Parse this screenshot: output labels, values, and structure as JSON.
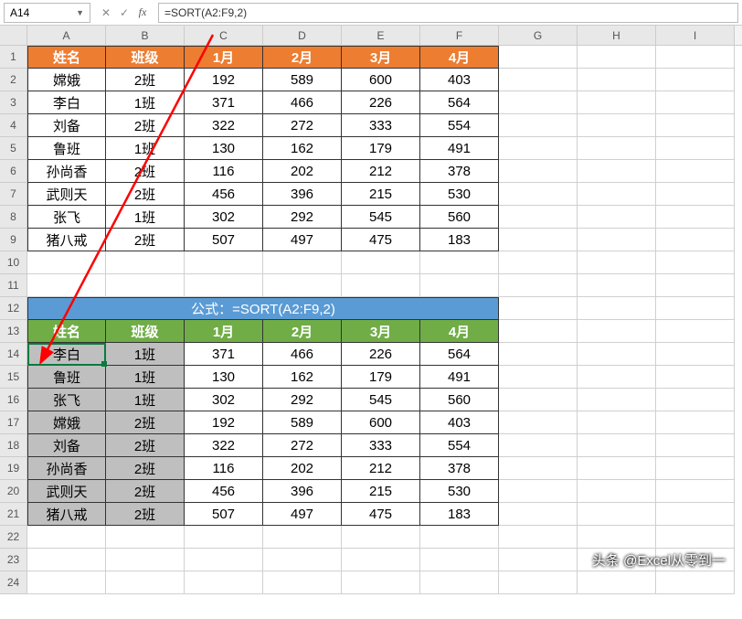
{
  "name_box": "A14",
  "formula": "=SORT(A2:F9,2)",
  "columns": [
    "A",
    "B",
    "C",
    "D",
    "E",
    "F",
    "G",
    "H",
    "I"
  ],
  "row_numbers": [
    "1",
    "2",
    "3",
    "4",
    "5",
    "6",
    "7",
    "8",
    "9",
    "10",
    "11",
    "12",
    "13",
    "14",
    "15",
    "16",
    "17",
    "18",
    "19",
    "20",
    "21",
    "22",
    "23",
    "24"
  ],
  "table1": {
    "headers": [
      "姓名",
      "班级",
      "1月",
      "2月",
      "3月",
      "4月"
    ],
    "rows": [
      [
        "嫦娥",
        "2班",
        "192",
        "589",
        "600",
        "403"
      ],
      [
        "李白",
        "1班",
        "371",
        "466",
        "226",
        "564"
      ],
      [
        "刘备",
        "2班",
        "322",
        "272",
        "333",
        "554"
      ],
      [
        "鲁班",
        "1班",
        "130",
        "162",
        "179",
        "491"
      ],
      [
        "孙尚香",
        "2班",
        "116",
        "202",
        "212",
        "378"
      ],
      [
        "武则天",
        "2班",
        "456",
        "396",
        "215",
        "530"
      ],
      [
        "张飞",
        "1班",
        "302",
        "292",
        "545",
        "560"
      ],
      [
        "猪八戒",
        "2班",
        "507",
        "497",
        "475",
        "183"
      ]
    ]
  },
  "banner": "公式：=SORT(A2:F9,2)",
  "table2": {
    "headers": [
      "姓名",
      "班级",
      "1月",
      "2月",
      "3月",
      "4月"
    ],
    "rows": [
      [
        "李白",
        "1班",
        "371",
        "466",
        "226",
        "564"
      ],
      [
        "鲁班",
        "1班",
        "130",
        "162",
        "179",
        "491"
      ],
      [
        "张飞",
        "1班",
        "302",
        "292",
        "545",
        "560"
      ],
      [
        "嫦娥",
        "2班",
        "192",
        "589",
        "600",
        "403"
      ],
      [
        "刘备",
        "2班",
        "322",
        "272",
        "333",
        "554"
      ],
      [
        "孙尚香",
        "2班",
        "116",
        "202",
        "212",
        "378"
      ],
      [
        "武则天",
        "2班",
        "456",
        "396",
        "215",
        "530"
      ],
      [
        "猪八戒",
        "2班",
        "507",
        "497",
        "475",
        "183"
      ]
    ]
  },
  "watermark": "头条 @Excel从零到一",
  "icons": {
    "cancel": "✕",
    "confirm": "✓",
    "fx": "fx",
    "dropdown": "▼"
  }
}
